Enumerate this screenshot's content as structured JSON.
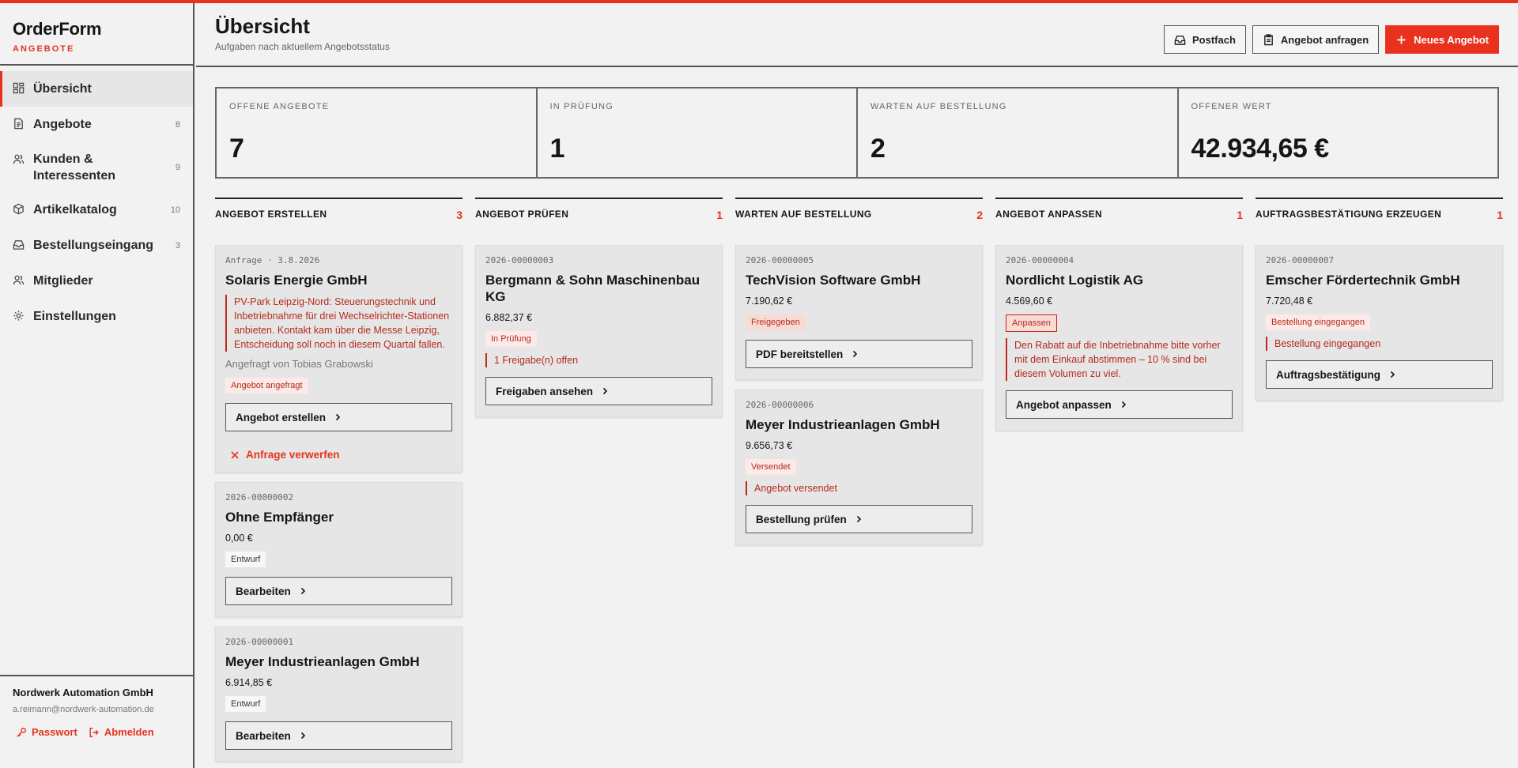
{
  "brand": {
    "name": "OrderForm",
    "sub": "ANGEBOTE"
  },
  "nav": [
    {
      "label": "Übersicht",
      "icon": "dashboard-icon",
      "count": ""
    },
    {
      "label": "Angebote",
      "icon": "document-icon",
      "count": "8"
    },
    {
      "label": "Kunden & Interessenten",
      "icon": "users-icon",
      "count": "9"
    },
    {
      "label": "Artikelkatalog",
      "icon": "box-icon",
      "count": "10"
    },
    {
      "label": "Bestellungseingang",
      "icon": "inbox-icon",
      "count": "3"
    },
    {
      "label": "Mitglieder",
      "icon": "members-icon",
      "count": ""
    },
    {
      "label": "Einstellungen",
      "icon": "gear-icon",
      "count": ""
    }
  ],
  "account": {
    "company": "Nordwerk Automation GmbH",
    "email": "a.reimann@nordwerk-automation.de",
    "password": "Passwort",
    "logout": "Abmelden"
  },
  "header": {
    "title": "Übersicht",
    "subtitle": "Aufgaben nach aktuellem Angebotsstatus",
    "inbox": "Postfach",
    "request": "Angebot anfragen",
    "new": "Neues Angebot"
  },
  "stats": [
    {
      "label": "OFFENE ANGEBOTE",
      "value": "7"
    },
    {
      "label": "IN PRÜFUNG",
      "value": "1"
    },
    {
      "label": "WARTEN AUF BESTELLUNG",
      "value": "2"
    },
    {
      "label": "OFFENER WERT",
      "value": "42.934,65 €"
    }
  ],
  "columns": {
    "c1": {
      "title": "ANGEBOT ERSTELLEN",
      "count": "3",
      "cards": [
        {
          "id": "Anfrage · 3.8.2026",
          "title": "Solaris Energie GmbH",
          "note": "PV-Park Leipzig-Nord: Steuerungstechnik und Inbetriebnahme für drei Wechselrichter-Stationen anbieten. Kontakt kam über die Messe Leipzig, Entscheidung soll noch in diesem Quartal fallen.",
          "requested_by": "Angefragt von Tobias Grabowski",
          "badge": "Angebot angefragt",
          "action": "Angebot erstellen",
          "reject": "Anfrage verwerfen"
        },
        {
          "id": "2026-00000002",
          "title": "Ohne Empfänger",
          "amount": "0,00 €",
          "badge": "Entwurf",
          "action": "Bearbeiten"
        },
        {
          "id": "2026-00000001",
          "title": "Meyer Industrieanlagen GmbH",
          "amount": "6.914,85 €",
          "badge": "Entwurf",
          "action": "Bearbeiten"
        }
      ]
    },
    "c2": {
      "title": "ANGEBOT PRÜFEN",
      "count": "1",
      "cards": [
        {
          "id": "2026-00000003",
          "title": "Bergmann & Sohn Maschinenbau KG",
          "amount": "6.882,37 €",
          "badge": "In Prüfung",
          "note": "1 Freigabe(n) offen",
          "action": "Freigaben ansehen"
        }
      ]
    },
    "c3": {
      "title": "WARTEN AUF BESTELLUNG",
      "count": "2",
      "cards": [
        {
          "id": "2026-00000005",
          "title": "TechVision Software GmbH",
          "amount": "7.190,62 €",
          "badge": "Freigegeben",
          "action": "PDF bereitstellen"
        },
        {
          "id": "2026-00000006",
          "title": "Meyer Industrieanlagen GmbH",
          "amount": "9.656,73 €",
          "badge": "Versendet",
          "note": "Angebot versendet",
          "action": "Bestellung prüfen"
        }
      ]
    },
    "c4": {
      "title": "ANGEBOT ANPASSEN",
      "count": "1",
      "cards": [
        {
          "id": "2026-00000004",
          "title": "Nordlicht Logistik AG",
          "amount": "4.569,60 €",
          "badge": "Anpassen",
          "note": "Den Rabatt auf die Inbetriebnahme bitte vorher mit dem Einkauf abstimmen – 10 % sind bei diesem Volumen zu viel.",
          "action": "Angebot anpassen"
        }
      ]
    },
    "c5": {
      "title": "AUFTRAGSBESTÄTIGUNG ERZEUGEN",
      "count": "1",
      "cards": [
        {
          "id": "2026-00000007",
          "title": "Emscher Fördertechnik GmbH",
          "amount": "7.720,48 €",
          "badge": "Bestellung eingegangen",
          "note": "Bestellung eingegangen",
          "action": "Auftragsbestätigung"
        }
      ]
    }
  },
  "colors": {
    "accent": "#e8321e",
    "note": "#b52a1c",
    "card": "#e6e6e6",
    "background": "#f2f2f2"
  }
}
